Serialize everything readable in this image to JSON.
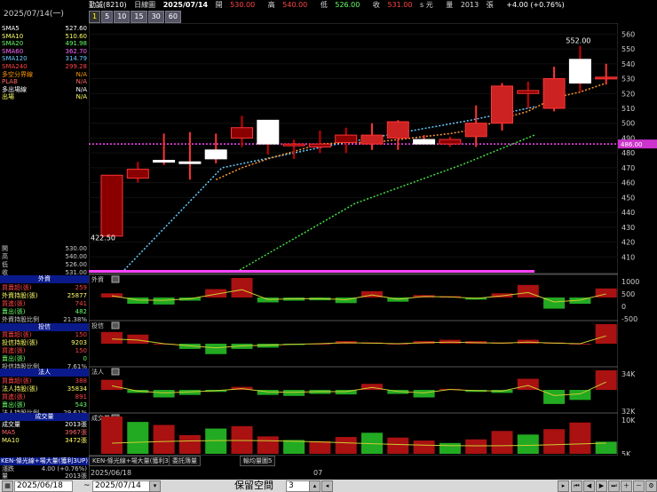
{
  "left_panel": {
    "date": "2025/07/14(一)",
    "ma": [
      {
        "k": "SMA5",
        "v": "527.60",
        "c": "#ffffff"
      },
      {
        "k": "SMA10",
        "v": "510.60",
        "c": "#ffff66"
      },
      {
        "k": "SMA20",
        "v": "491.98",
        "c": "#66ff66"
      },
      {
        "k": "SMA60",
        "v": "362.70",
        "c": "#ff66ff"
      },
      {
        "k": "SMA120",
        "v": "314.79",
        "c": "#66ccff"
      },
      {
        "k": "SMA240",
        "v": "299.28",
        "c": "#ff4444"
      },
      {
        "k": "多空分界線",
        "v": "N/A",
        "c": "#ff9900"
      },
      {
        "k": "PLAB",
        "v": "N/A",
        "c": "#ff6666"
      },
      {
        "k": "多出場線",
        "v": "N/A",
        "c": "#ffffff"
      },
      {
        "k": "出場",
        "v": "N/A",
        "c": "#ffff66"
      }
    ],
    "ohlc": [
      {
        "k": "開",
        "v": "530.00"
      },
      {
        "k": "高",
        "v": "540.00"
      },
      {
        "k": "低",
        "v": "526.00"
      },
      {
        "k": "收",
        "v": "531.00"
      }
    ],
    "foreign_title": "外資",
    "foreign": [
      {
        "k": "買賣超(張)",
        "v": "259"
      },
      {
        "k": "外資持股(張)",
        "v": "25877"
      },
      {
        "k": "買進(張)",
        "v": "741"
      },
      {
        "k": "賣出(張)",
        "v": "482"
      },
      {
        "k": "外資持股比例",
        "v": "21.38%"
      }
    ],
    "trust_title": "投信",
    "trust": [
      {
        "k": "買賣超(張)",
        "v": "150"
      },
      {
        "k": "投信持股(張)",
        "v": "9203"
      },
      {
        "k": "買進(張)",
        "v": "150"
      },
      {
        "k": "賣出(張)",
        "v": "0"
      },
      {
        "k": "投信持股比例",
        "v": "7.61%"
      }
    ],
    "inst_title": "法人",
    "inst": [
      {
        "k": "買賣超(張)",
        "v": "388"
      },
      {
        "k": "法人持股(張)",
        "v": "35834"
      },
      {
        "k": "買進(張)",
        "v": "891"
      },
      {
        "k": "賣出(張)",
        "v": "543"
      },
      {
        "k": "法人持股比例",
        "v": "29.61%"
      }
    ],
    "vol_title": "成交量",
    "vol": [
      {
        "k": "成交量",
        "v": "2013張"
      },
      {
        "k": "MA5",
        "v": "3967張"
      },
      {
        "k": "MA10",
        "v": "3472張"
      }
    ],
    "ken_title": "KEN-條光線+場大量(獲利3UP)",
    "ken": [
      {
        "k": "漲跌",
        "v": "4.00 (+0.76%)"
      },
      {
        "k": "量",
        "v": "2013張"
      }
    ]
  },
  "topbar": {
    "name": "勤誠(8210)",
    "period": "日線圖",
    "date": "2025/07/14",
    "open_label": "開",
    "open": "530.00",
    "high_label": "高",
    "high": "540.00",
    "low_label": "低",
    "low": "526.00",
    "close_label": "收",
    "close": "531.00",
    "unit": "s 元",
    "vol_label": "量",
    "vol": "2013",
    "vol_unit": "張",
    "change": "+4.00 (+0.76%)"
  },
  "periods": [
    "1",
    "5",
    "10",
    "15",
    "30",
    "60"
  ],
  "active_period": "1",
  "price_axis": {
    "ticks": [
      "560",
      "550",
      "540",
      "530",
      "520",
      "510",
      "500",
      "490",
      "480",
      "470",
      "460",
      "450",
      "440",
      "430",
      "420",
      "410"
    ],
    "highlight": "486.00"
  },
  "annotations": {
    "high": "552.00",
    "low": "422.50"
  },
  "sub_panels": {
    "foreign_label": "外資",
    "foreign_ticks": [
      "1000",
      "500",
      "0",
      "-500"
    ],
    "trust_label": "投信",
    "inst_label": "法人",
    "inst_ticks": [
      "34K",
      "32K"
    ],
    "vol_label": "成交量",
    "vol_ticks": [
      "10K",
      "5K"
    ]
  },
  "footer_tabs": [
    "KEN-條光線+場大量(獲利3UP)",
    "委託簿量",
    "輸均量圖5"
  ],
  "date_labels": {
    "start": "2025/06/18",
    "mid": "07"
  },
  "statusbar": {
    "from": "2025/06/18",
    "sep": "~",
    "to": "2025/07/14",
    "space_label": "保留空間",
    "space_value": "3"
  },
  "chart_data": {
    "type": "candlestick",
    "candles": [
      {
        "o": 465,
        "h": 465,
        "l": 424,
        "c": 424
      },
      {
        "o": 469,
        "h": 474,
        "l": 460,
        "c": 463
      },
      {
        "o": 475,
        "h": 493,
        "l": 472,
        "c": 475
      },
      {
        "o": 474,
        "h": 494,
        "l": 462,
        "c": 474
      },
      {
        "o": 476,
        "h": 493,
        "l": 473,
        "c": 482
      },
      {
        "o": 497,
        "h": 505,
        "l": 484,
        "c": 490
      },
      {
        "o": 502,
        "h": 502,
        "l": 479,
        "c": 486
      },
      {
        "o": 486,
        "h": 489,
        "l": 476,
        "c": 485
      },
      {
        "o": 486,
        "h": 495,
        "l": 480,
        "c": 484
      },
      {
        "o": 492,
        "h": 497,
        "l": 480,
        "c": 487
      },
      {
        "o": 486,
        "h": 500,
        "l": 482,
        "c": 492
      },
      {
        "o": 490,
        "h": 502,
        "l": 482,
        "c": 501
      },
      {
        "o": 486,
        "h": 492,
        "l": 486,
        "c": 489
      },
      {
        "o": 489,
        "h": 491,
        "l": 484,
        "c": 486
      },
      {
        "o": 491,
        "h": 512,
        "l": 484,
        "c": 500
      },
      {
        "o": 500,
        "h": 527,
        "l": 495,
        "c": 525
      },
      {
        "o": 522,
        "h": 528,
        "l": 510,
        "c": 520
      },
      {
        "o": 510,
        "h": 538,
        "l": 508,
        "c": 530
      },
      {
        "o": 543,
        "h": 552,
        "l": 521,
        "c": 527
      },
      {
        "o": 530,
        "h": 540,
        "l": 526,
        "c": 531
      }
    ],
    "ma5": [
      null,
      null,
      null,
      null,
      462,
      470,
      476,
      481,
      486,
      487,
      487,
      489,
      491,
      493,
      496,
      503,
      508,
      517,
      521,
      527
    ],
    "ma10": [
      null,
      null,
      null,
      null,
      null,
      null,
      null,
      null,
      null,
      472,
      476,
      480,
      484,
      486,
      488,
      492,
      496,
      500,
      505,
      511
    ],
    "ma20": [
      null,
      null,
      null,
      null,
      null,
      null,
      null,
      null,
      null,
      null,
      null,
      null,
      null,
      null,
      null,
      null,
      null,
      null,
      null,
      492
    ],
    "foreign": [
      120,
      -180,
      -200,
      -90,
      240,
      560,
      -140,
      -90,
      -80,
      -160,
      180,
      -120,
      70,
      40,
      -60,
      120,
      360,
      -320,
      -180,
      259
    ],
    "trust": [
      90,
      70,
      0,
      -40,
      -80,
      -40,
      -30,
      -10,
      0,
      20,
      10,
      0,
      20,
      30,
      20,
      10,
      30,
      10,
      0,
      150
    ],
    "inst": [
      200,
      -60,
      -150,
      -100,
      -40,
      60,
      -100,
      -120,
      -80,
      -90,
      120,
      -80,
      -150,
      20,
      -40,
      -60,
      220,
      -280,
      -200,
      388
    ],
    "volume": [
      6200,
      5300,
      4800,
      3100,
      4200,
      4600,
      2900,
      2300,
      2100,
      2800,
      3500,
      2700,
      2200,
      1800,
      2400,
      3800,
      3200,
      4100,
      5200,
      2013
    ]
  }
}
